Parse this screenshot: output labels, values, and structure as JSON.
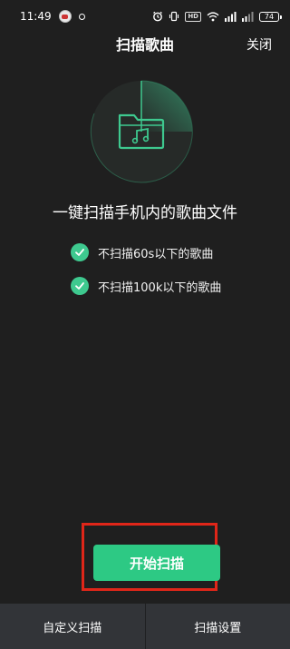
{
  "status_bar": {
    "time": "11:49",
    "hd_label": "HD",
    "battery": "74"
  },
  "header": {
    "title": "扫描歌曲",
    "close_label": "关闭"
  },
  "hero": {
    "icon": "music-folder-icon",
    "accent_color": "#3ec98f"
  },
  "main": {
    "heading": "一键扫描手机内的歌曲文件",
    "features": [
      {
        "label": "不扫描60s以下的歌曲",
        "checked": true
      },
      {
        "label": "不扫描100k以下的歌曲",
        "checked": true
      }
    ],
    "start_button_label": "开始扫描"
  },
  "bottom_bar": {
    "tabs": [
      {
        "label": "自定义扫描"
      },
      {
        "label": "扫描设置"
      }
    ]
  },
  "colors": {
    "background": "#1f1f1f",
    "accent": "#2dc984",
    "highlight_box": "#e02619",
    "bottom_bar": "#323438"
  }
}
